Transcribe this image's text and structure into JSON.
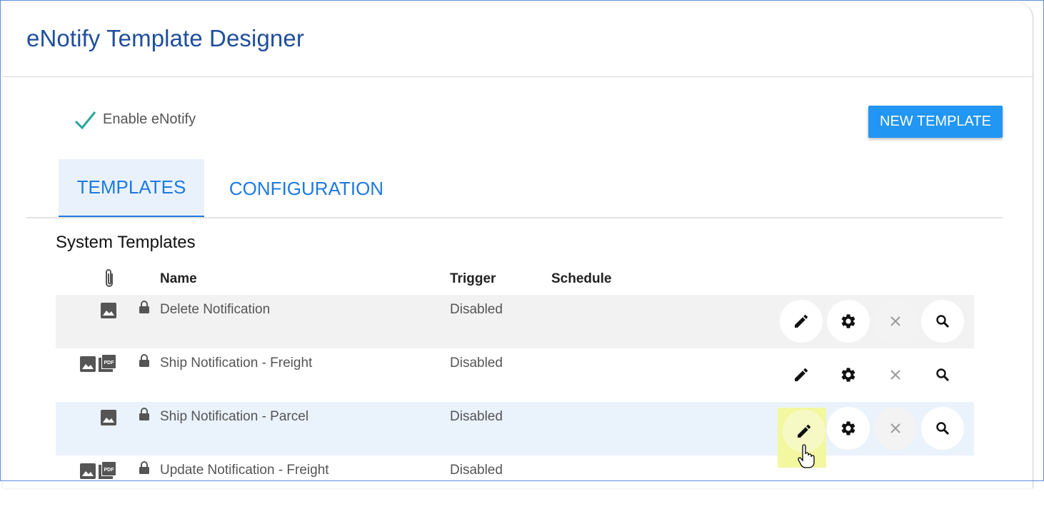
{
  "header": {
    "title": "eNotify Template Designer"
  },
  "enable": {
    "label": "Enable eNotify",
    "checked": true,
    "check_color": "#26a69a"
  },
  "new_template_label": "NEW TEMPLATE",
  "tabs": [
    {
      "label": "TEMPLATES",
      "active": true
    },
    {
      "label": "CONFIGURATION",
      "active": false
    }
  ],
  "section_title": "System Templates",
  "columns": {
    "attachments_icon": "paperclip-icon",
    "name": "Name",
    "trigger": "Trigger",
    "schedule": "Schedule"
  },
  "rows": [
    {
      "name": "Delete Notification",
      "trigger": "Disabled",
      "attachments": [
        "image-icon"
      ],
      "locked": true
    },
    {
      "name": "Ship Notification - Freight",
      "trigger": "Disabled",
      "attachments": [
        "image-icon",
        "pdf-icon"
      ],
      "locked": true
    },
    {
      "name": "Ship Notification - Parcel",
      "trigger": "Disabled",
      "attachments": [
        "image-icon"
      ],
      "locked": true
    },
    {
      "name": "Update Notification - Freight",
      "trigger": "Disabled",
      "attachments": [
        "image-icon",
        "pdf-icon"
      ],
      "locked": true
    }
  ],
  "row_actions": [
    "pencil-icon",
    "gear-icon",
    "close-icon",
    "search-icon"
  ],
  "colors": {
    "title": "#1f4e9c",
    "accent": "#2196f3",
    "tab": "#1e7ae0",
    "highlight": "#f3f7a0"
  }
}
